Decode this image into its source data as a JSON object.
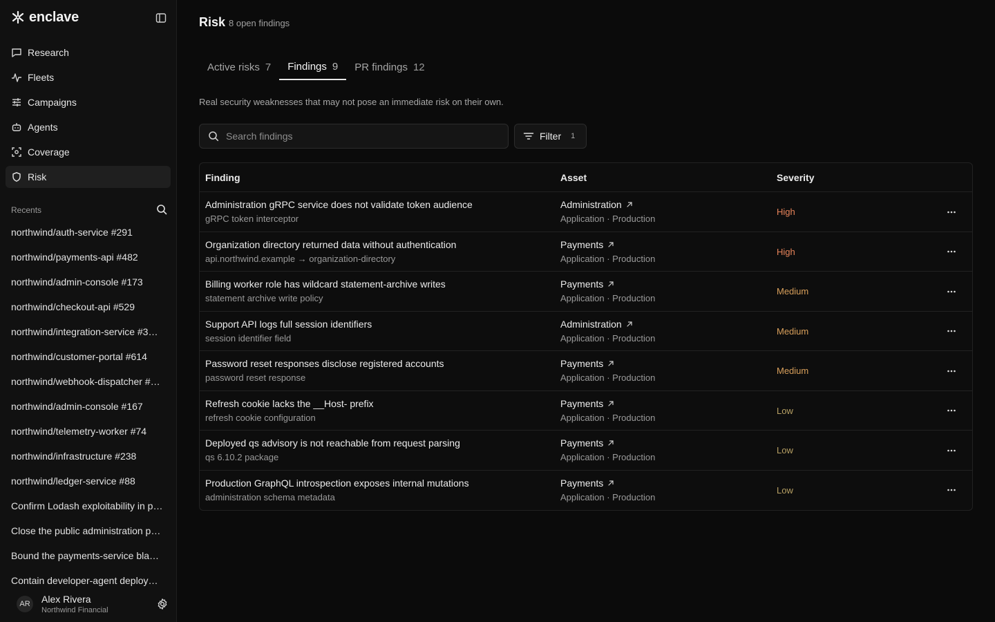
{
  "brand": {
    "name": "enclave"
  },
  "nav": [
    {
      "label": "Research",
      "icon": "chat-bubble-icon",
      "active": false
    },
    {
      "label": "Fleets",
      "icon": "activity-icon",
      "active": false
    },
    {
      "label": "Campaigns",
      "icon": "sliders-icon",
      "active": false
    },
    {
      "label": "Agents",
      "icon": "bot-icon",
      "active": false
    },
    {
      "label": "Coverage",
      "icon": "scan-icon",
      "active": false
    },
    {
      "label": "Risk",
      "icon": "shield-icon",
      "active": true
    }
  ],
  "recents": {
    "title": "Recents",
    "items": [
      "northwind/auth-service #291",
      "northwind/payments-api #482",
      "northwind/admin-console #173",
      "northwind/checkout-api #529",
      "northwind/integration-service #3…",
      "northwind/customer-portal #614",
      "northwind/webhook-dispatcher #…",
      "northwind/admin-console #167",
      "northwind/telemetry-worker #74",
      "northwind/infrastructure #238",
      "northwind/ledger-service #88",
      "Confirm Lodash exploitability in p…",
      "Close the public administration p…",
      "Bound the payments-service bla…",
      "Contain developer-agent deploy…"
    ]
  },
  "user": {
    "initials": "AR",
    "name": "Alex Rivera",
    "org": "Northwind Financial"
  },
  "page": {
    "title": "Risk",
    "subtitle": "8 open findings"
  },
  "tabs": [
    {
      "label": "Active risks",
      "count": "7",
      "active": false
    },
    {
      "label": "Findings",
      "count": "9",
      "active": true
    },
    {
      "label": "PR findings",
      "count": "12",
      "active": false
    }
  ],
  "description": "Real security weaknesses that may not pose an immediate risk on their own.",
  "search": {
    "placeholder": "Search findings"
  },
  "filter": {
    "label": "Filter",
    "count": "1"
  },
  "table": {
    "headers": {
      "finding": "Finding",
      "asset": "Asset",
      "severity": "Severity"
    },
    "rows": [
      {
        "title": "Administration gRPC service does not validate token audience",
        "detail": "gRPC token interceptor",
        "asset": "Administration",
        "asset_meta": "Application · Production",
        "severity": "High"
      },
      {
        "title": "Organization directory returned data without authentication",
        "detail": "api.northwind.example → organization-directory",
        "asset": "Payments",
        "asset_meta": "Application · Production",
        "severity": "High"
      },
      {
        "title": "Billing worker role has wildcard statement-archive writes",
        "detail": "statement archive write policy",
        "asset": "Payments",
        "asset_meta": "Application · Production",
        "severity": "Medium"
      },
      {
        "title": "Support API logs full session identifiers",
        "detail": "session identifier field",
        "asset": "Administration",
        "asset_meta": "Application · Production",
        "severity": "Medium"
      },
      {
        "title": "Password reset responses disclose registered accounts",
        "detail": "password reset response",
        "asset": "Payments",
        "asset_meta": "Application · Production",
        "severity": "Medium"
      },
      {
        "title": "Refresh cookie lacks the __Host- prefix",
        "detail": "refresh cookie configuration",
        "asset": "Payments",
        "asset_meta": "Application · Production",
        "severity": "Low"
      },
      {
        "title": "Deployed qs advisory is not reachable from request parsing",
        "detail": "qs 6.10.2 package",
        "asset": "Payments",
        "asset_meta": "Application · Production",
        "severity": "Low"
      },
      {
        "title": "Production GraphQL introspection exposes internal mutations",
        "detail": "administration schema metadata",
        "asset": "Payments",
        "asset_meta": "Application · Production",
        "severity": "Low"
      }
    ]
  },
  "colors": {
    "high": "#e8845a",
    "medium": "#d9a05b",
    "low": "#b7a064"
  }
}
